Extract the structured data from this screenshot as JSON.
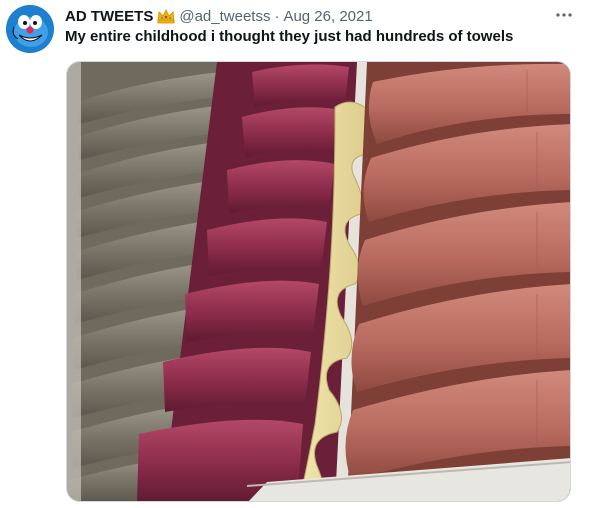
{
  "tweet": {
    "author": {
      "display_name": "AD TWEETS",
      "handle": "@ad_tweetss",
      "avatar_icon": "oggy-cartoon-avatar",
      "badge_icon": "crown-emoji"
    },
    "separator": "·",
    "date": "Aug 26, 2021",
    "text": "My entire childhood i thought they just had hundreds of towels",
    "more_icon": "more-dots-icon",
    "media": {
      "kind": "photo",
      "subject": "folded towels on a store shelf with foam inserts"
    }
  },
  "colors": {
    "text_primary": "#0f1419",
    "text_secondary": "#536471",
    "border": "#cfd9de",
    "avatar_bg": "#1d7fcf",
    "towel_maroon": "#8e2d4c",
    "towel_coral": "#b86a5e",
    "towel_gray": "#8c8579",
    "foam": "#e9dca2"
  }
}
